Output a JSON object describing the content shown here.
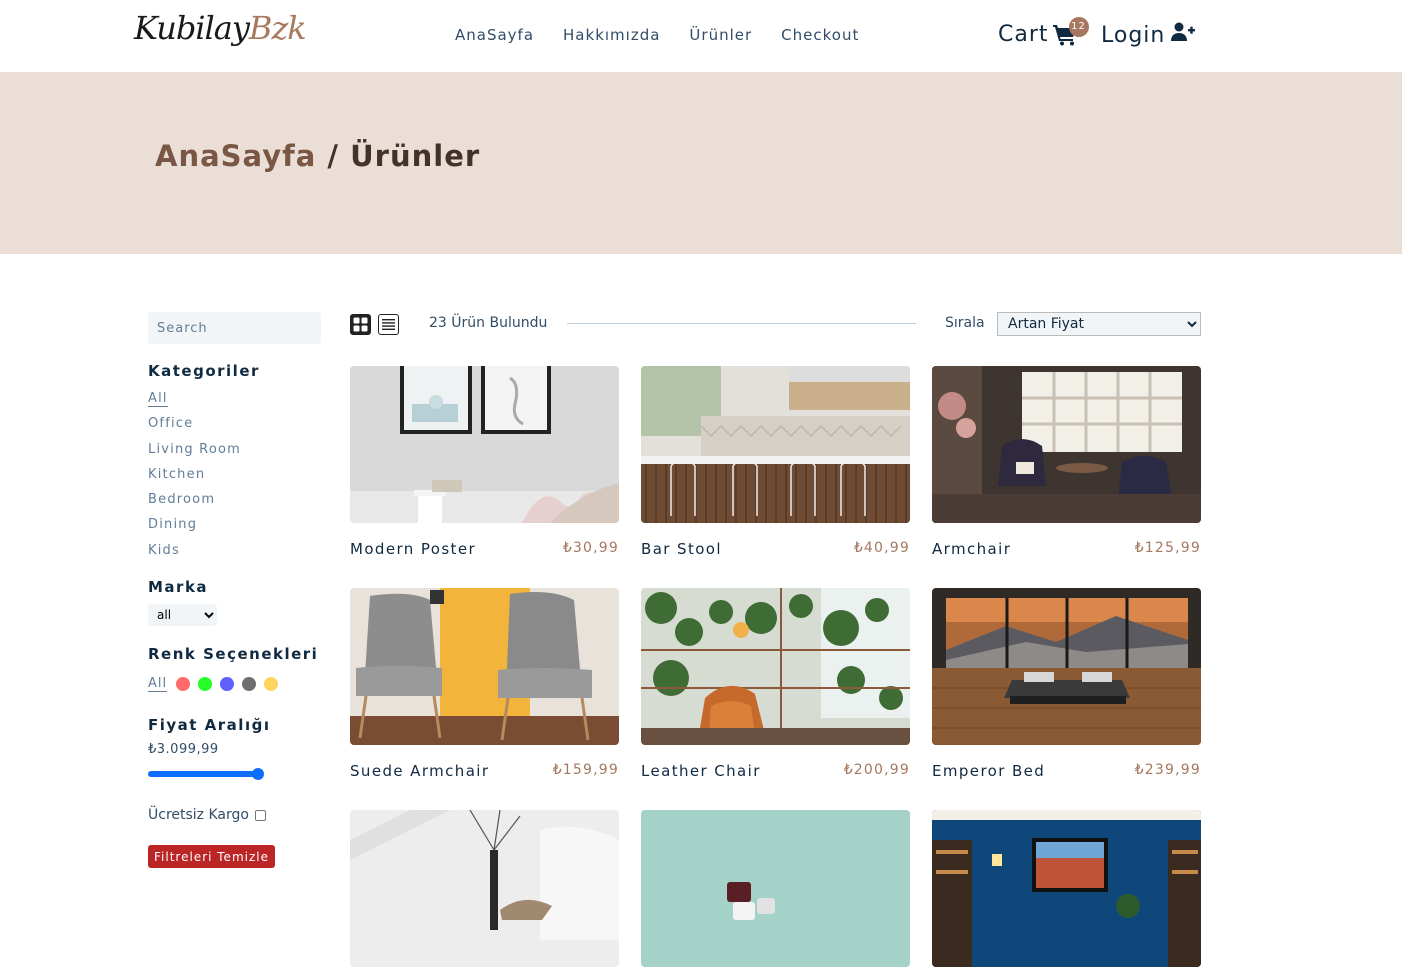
{
  "nav": {
    "logo_a": "Kubilay",
    "logo_b": "Bzk",
    "links": [
      "AnaSayfa",
      "Hakkımızda",
      "Ürünler",
      "Checkout"
    ],
    "cart_label": "Cart",
    "cart_count": "12",
    "login_label": "Login"
  },
  "hero": {
    "crumb_home": "AnaSayfa",
    "crumb_sep": " / ",
    "crumb_current": "Ürünler"
  },
  "sidebar": {
    "search_placeholder": "Search",
    "categories_title": "Kategoriler",
    "categories": [
      "All",
      "Office",
      "Living Room",
      "Kitchen",
      "Bedroom",
      "Dining",
      "Kids"
    ],
    "brand_title": "Marka",
    "brand_selected": "all",
    "colors_title": "Renk Seçenekleri",
    "colors_all": "All",
    "colors": [
      "#ff5050",
      "#00ff00",
      "#4444ff",
      "#555555",
      "#ffcc44"
    ],
    "price_title": "Fiyat Aralığı",
    "price_value": "₺3.099,99",
    "price_fraction": 1.0,
    "shipping_label": "Ücretsiz Kargo",
    "clear_label": "Filtreleri Temizle"
  },
  "toolbar": {
    "found": "23 Ürün Bulundu",
    "sort_label": "Sırala",
    "sort_selected": "Artan Fiyat"
  },
  "products": [
    {
      "name": "Modern Poster",
      "price": "₺30,99"
    },
    {
      "name": "Bar Stool",
      "price": "₺40,99"
    },
    {
      "name": "Armchair",
      "price": "₺125,99"
    },
    {
      "name": "Suede Armchair",
      "price": "₺159,99"
    },
    {
      "name": "Leather Chair",
      "price": "₺200,99"
    },
    {
      "name": "Emperor Bed",
      "price": "₺239,99"
    }
  ],
  "colors": {
    "accent": "#a5785f",
    "hero_bg": "#eaded7",
    "clear_btn": "#bb2525"
  }
}
